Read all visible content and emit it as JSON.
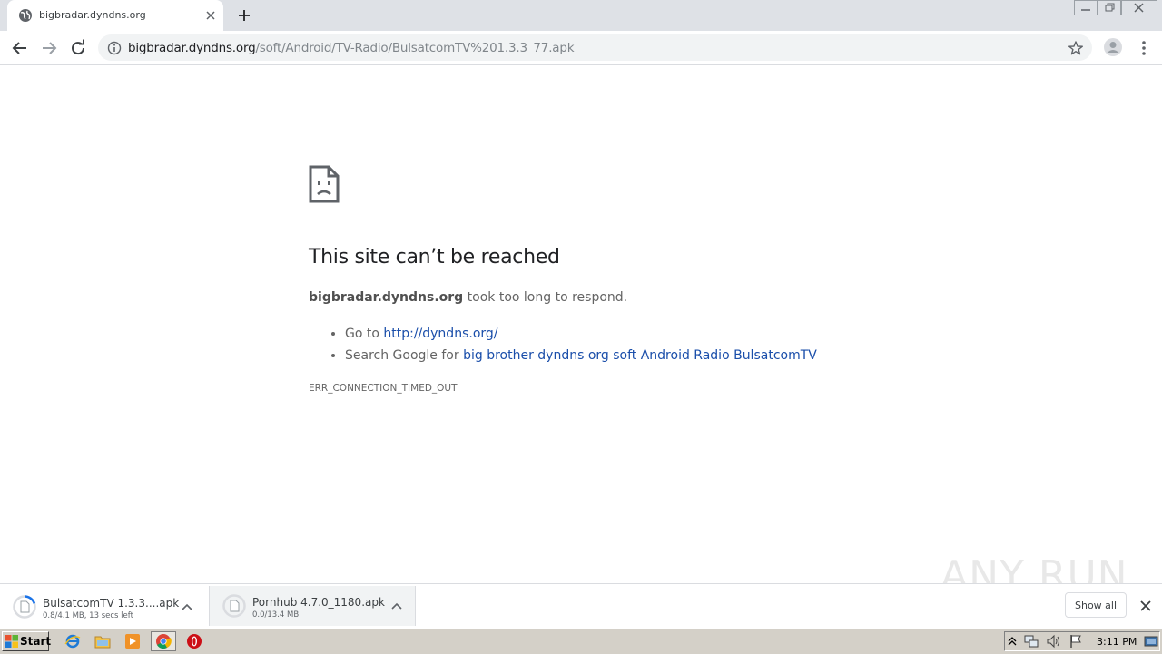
{
  "tab": {
    "title": "bigbradar.dyndns.org"
  },
  "omnibox": {
    "host": "bigbradar.dyndns.org",
    "path": "/soft/Android/TV-Radio/BulsatcomTV%201.3.3_77.apk"
  },
  "error": {
    "heading": "This site can’t be reached",
    "host": "bigbradar.dyndns.org",
    "summary_suffix": " took too long to respond.",
    "suggestions": [
      {
        "prefix": "Go to ",
        "link": "http://dyndns.org/"
      },
      {
        "prefix": "Search Google for ",
        "link": "big brother dyndns org soft Android Radio BulsatcomTV"
      }
    ],
    "code": "ERR_CONNECTION_TIMED_OUT"
  },
  "downloads": {
    "items": [
      {
        "name": "BulsatcomTV 1.3.3....apk",
        "status": "0.8/4.1 MB, 13 secs left",
        "progress": 0.2
      },
      {
        "name": "Pornhub 4.7.0_1180.apk",
        "status": "0.0/13.4 MB",
        "progress": 0.0
      }
    ],
    "show_all": "Show all"
  },
  "watermark": "ANY RUN",
  "taskbar": {
    "start": "Start",
    "clock": "3:11 PM"
  },
  "icons": {
    "tab_favicon": "globe-icon",
    "back": "arrow-left-icon",
    "forward": "arrow-right-icon",
    "reload": "reload-icon",
    "info": "info-icon",
    "star": "star-icon",
    "profile": "avatar-icon",
    "menu": "kebab-menu-icon"
  },
  "colors": {
    "link": "#1a4eaa",
    "tabstrip": "#dee1e6",
    "taskbar": "#d4d0c8"
  }
}
